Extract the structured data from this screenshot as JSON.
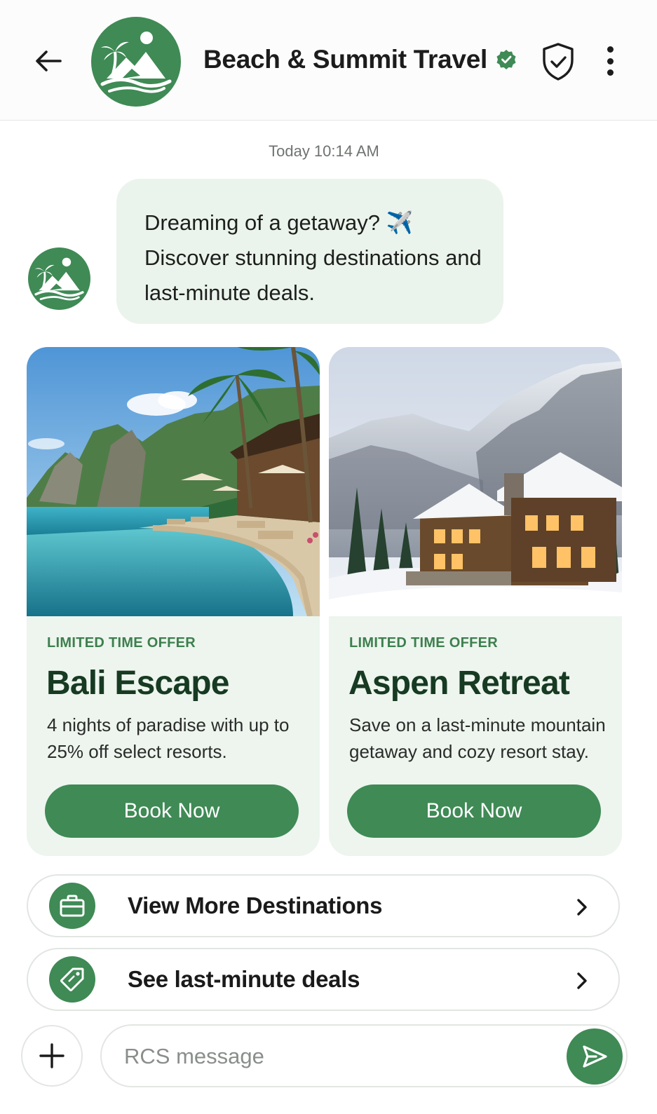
{
  "header": {
    "title": "Beach & Summit Travel",
    "back_icon": "arrow-left-icon",
    "verified_icon": "verified-badge-icon",
    "shield_icon": "shield-check-icon",
    "more_icon": "more-vertical-icon"
  },
  "conversation": {
    "timestamp": "Today 10:14 AM",
    "message_lines": [
      "Dreaming of a getaway? ✈️",
      "Discover stunning destinations and",
      "last-minute deals."
    ]
  },
  "cards": [
    {
      "tag": "LIMITED TIME OFFER",
      "title": "Bali Escape",
      "description": "4 nights of paradise with up to 25% off select resorts.",
      "button": "Book Now",
      "image": "tropical-resort-infinity-pool"
    },
    {
      "tag": "LIMITED TIME OFFER",
      "title": "Aspen Retreat",
      "description": "Save on a last-minute mountain getaway and cozy resort stay.",
      "button": "Book Now",
      "image": "snowy-mountain-lodge"
    }
  ],
  "suggestions": [
    {
      "label": "View More Destinations",
      "icon": "briefcase-icon"
    },
    {
      "label": "See last-minute deals",
      "icon": "tag-icon"
    }
  ],
  "composer": {
    "placeholder": "RCS message",
    "add_icon": "plus-icon",
    "send_icon": "send-icon"
  },
  "colors": {
    "brand_green": "#3f8a55",
    "card_bg": "#edf5ee",
    "bubble_bg": "#ebf4ec",
    "title_dark_green": "#173a22"
  }
}
